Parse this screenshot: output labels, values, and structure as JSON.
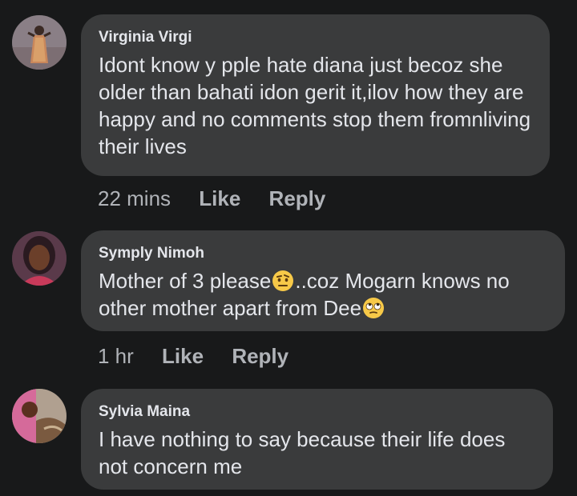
{
  "comments": [
    {
      "author": "Virginia Virgi",
      "text_parts": [
        "Idont know y pple hate diana just becoz she older than bahati idon gerit it,ilov how they are happy and no comments stop them fromnliving their lives"
      ],
      "time": "22 mins",
      "like": "Like",
      "reply": "Reply",
      "avatar": "avatar-virginia-virgi"
    },
    {
      "author": "Symply Nimoh",
      "text_parts": [
        "Mother of 3 please",
        "..coz Mogarn knows no other mother apart from Dee"
      ],
      "emojis": [
        "face-with-raised-eyebrow-emoji",
        "face-with-rolling-eyes-emoji"
      ],
      "time": "1 hr",
      "like": "Like",
      "reply": "Reply",
      "avatar": "avatar-symply-nimoh"
    },
    {
      "author": "Sylvia Maina",
      "text_parts": [
        "I have nothing to say because their life does not concern me"
      ],
      "avatar": "avatar-sylvia-maina"
    }
  ],
  "colors": {
    "background": "#18191a",
    "bubble": "#3a3b3c",
    "text": "#e4e6eb",
    "meta": "#b0b3b8",
    "emoji_yellow": "#f7c948"
  }
}
